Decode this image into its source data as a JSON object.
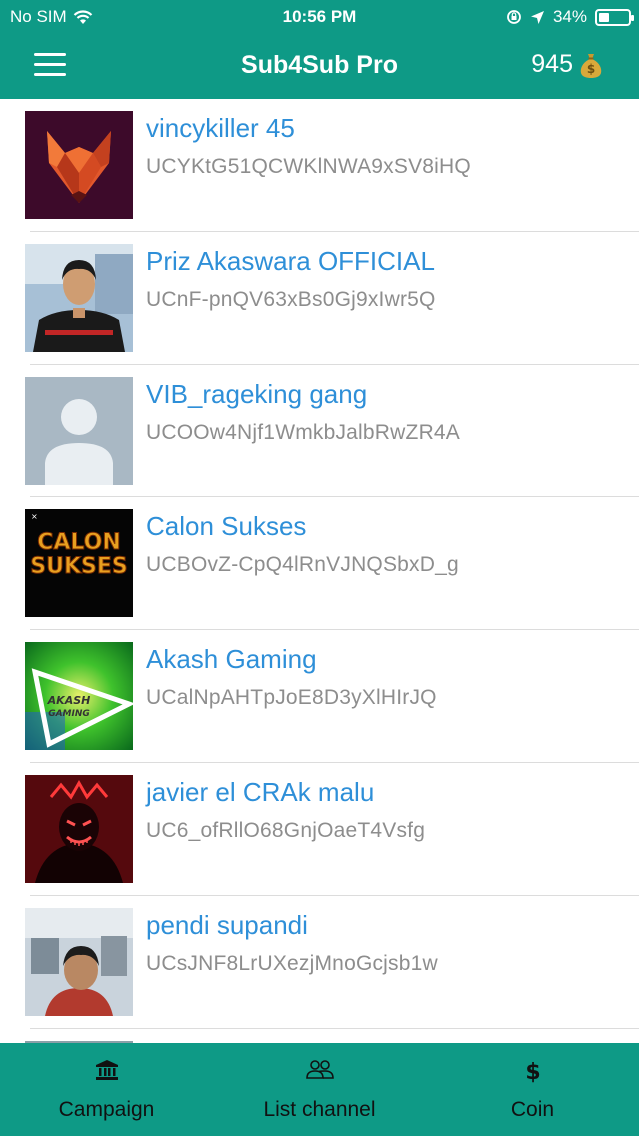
{
  "status_bar": {
    "carrier": "No SIM",
    "time": "10:56 PM",
    "battery": "34%"
  },
  "header": {
    "title": "Sub4Sub Pro",
    "coins": "945"
  },
  "channels": [
    {
      "name": "vincykiller 45",
      "id": "UCYKtG51QCWKlNWA9xSV8iHQ"
    },
    {
      "name": "Priz Akaswara OFFICIAL",
      "id": "UCnF-pnQV63xBs0Gj9xIwr5Q"
    },
    {
      "name": "VIB_rageking gang",
      "id": "UCOOw4Njf1WmkbJalbRwZR4A"
    },
    {
      "name": "Calon Sukses",
      "id": "UCBOvZ-CpQ4lRnVJNQSbxD_g"
    },
    {
      "name": "Akash Gaming",
      "id": "UCalNpAHTpJoE8D3yXlHIrJQ"
    },
    {
      "name": "javier el CRAk malu",
      "id": "UC6_ofRllO68GnjOaeT4Vsfg"
    },
    {
      "name": "pendi supandi",
      "id": "UCsJNF8LrUXezjMnoGcjsb1w"
    }
  ],
  "avatar_texts": {
    "calon_line1": "CALON",
    "calon_line2": "SUKSES",
    "akash_line1": "AKASH",
    "akash_line2": "GAMING"
  },
  "tabs": [
    {
      "label": "Campaign",
      "icon": "bank-icon"
    },
    {
      "label": "List channel",
      "icon": "people-icon"
    },
    {
      "label": "Coin",
      "icon": "dollar-icon"
    }
  ],
  "colors": {
    "brand": "#0e9a86",
    "channel_name": "#2e8fd8",
    "channel_id": "#8d8d8d"
  }
}
